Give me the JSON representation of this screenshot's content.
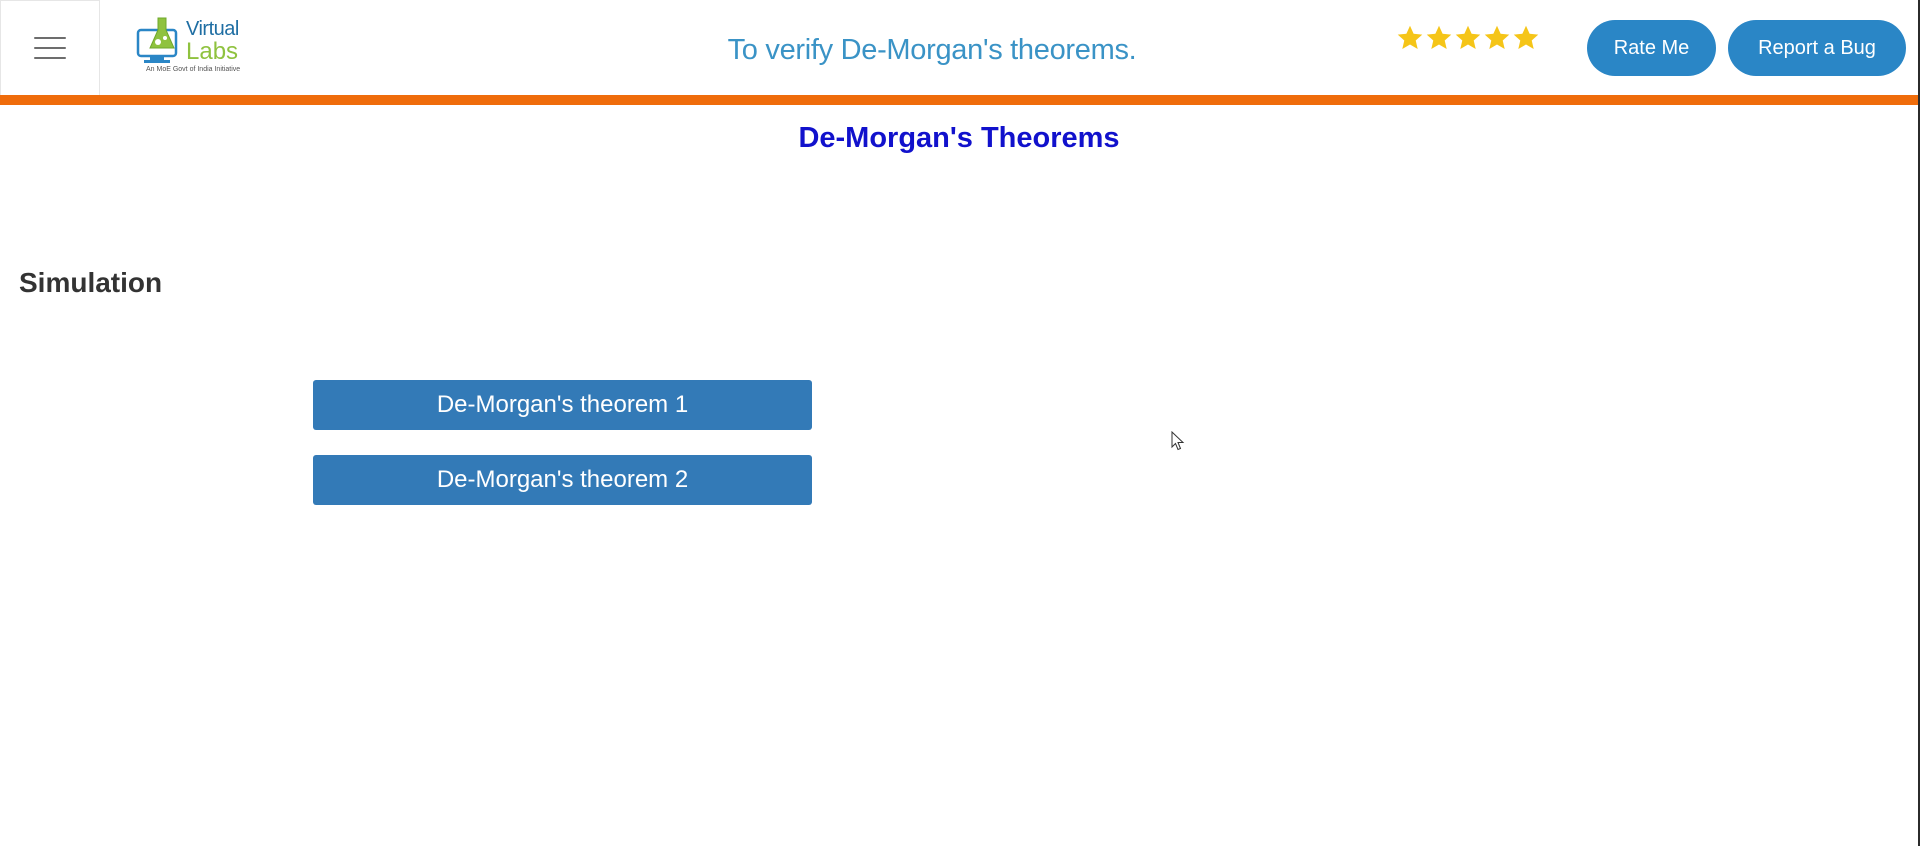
{
  "header": {
    "menu_icon": "hamburger-icon",
    "logo": {
      "line1": "Virtual",
      "line2": "Labs",
      "tagline": "An MoE Govt of India Initiative"
    },
    "heading": "To verify De-Morgan's theorems.",
    "rating": {
      "stars": 5,
      "max": 5,
      "star_color": "#f5c518",
      "icon": "star-icon"
    },
    "rate_label": "Rate Me",
    "bug_label": "Report a Bug"
  },
  "colors": {
    "accent_bar": "#ef6c0b",
    "button_blue": "#2a86c6",
    "sim_button_blue": "#337ab7",
    "title_blue": "#1111cc",
    "heading_blue": "#3a93c6"
  },
  "content": {
    "title": "De-Morgan's Theorems",
    "section": "Simulation",
    "buttons": [
      {
        "label": "De-Morgan's theorem 1"
      },
      {
        "label": "De-Morgan's theorem 2"
      }
    ]
  }
}
